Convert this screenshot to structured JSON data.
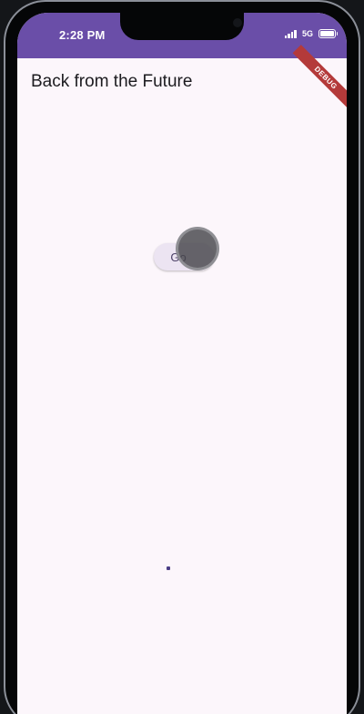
{
  "status_bar": {
    "time": "2:28 PM",
    "network": "5G"
  },
  "debug_banner": "DEBUG",
  "app": {
    "title": "Back from the Future",
    "button_label": "Go"
  },
  "colors": {
    "status_bar": "#6a4ea8",
    "screen_bg": "#fcf6fb",
    "button_bg": "#ece4f2",
    "debug": "#b43a3a"
  },
  "icons": [
    "signal-icon",
    "battery-icon",
    "touch-indicator"
  ]
}
